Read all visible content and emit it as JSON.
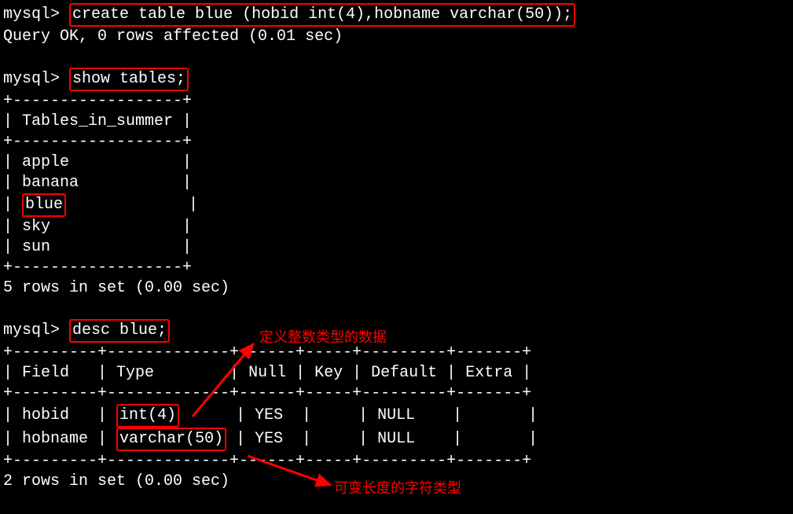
{
  "prompt": "mysql>",
  "commands": {
    "create": "create table blue (hobid int(4),hobname varchar(50));",
    "create_result": "Query OK, 0 rows affected (0.01 sec)",
    "show_tables": "show tables;",
    "desc": "desc blue;"
  },
  "tables_list": {
    "header": "Tables_in_summer",
    "rows": [
      "apple",
      "banana",
      "blue",
      "sky",
      "sun"
    ],
    "footer": "5 rows in set (0.00 sec)"
  },
  "desc_table": {
    "headers": [
      "Field",
      "Type",
      "Null",
      "Key",
      "Default",
      "Extra"
    ],
    "rows": [
      {
        "field": "hobid",
        "type": "int(4)",
        "null": "YES",
        "key": "",
        "default": "NULL",
        "extra": ""
      },
      {
        "field": "hobname",
        "type": "varchar(50)",
        "null": "YES",
        "key": "",
        "default": "NULL",
        "extra": ""
      }
    ],
    "footer": "2 rows in set (0.00 sec)"
  },
  "annotations": {
    "int_type": "定义整数类型的数据",
    "varchar_type": "可变长度的字符类型"
  },
  "separators": {
    "tables_sep": "+------------------+",
    "desc_sep": "+---------+-------------+------+-----+---------+-------+"
  }
}
